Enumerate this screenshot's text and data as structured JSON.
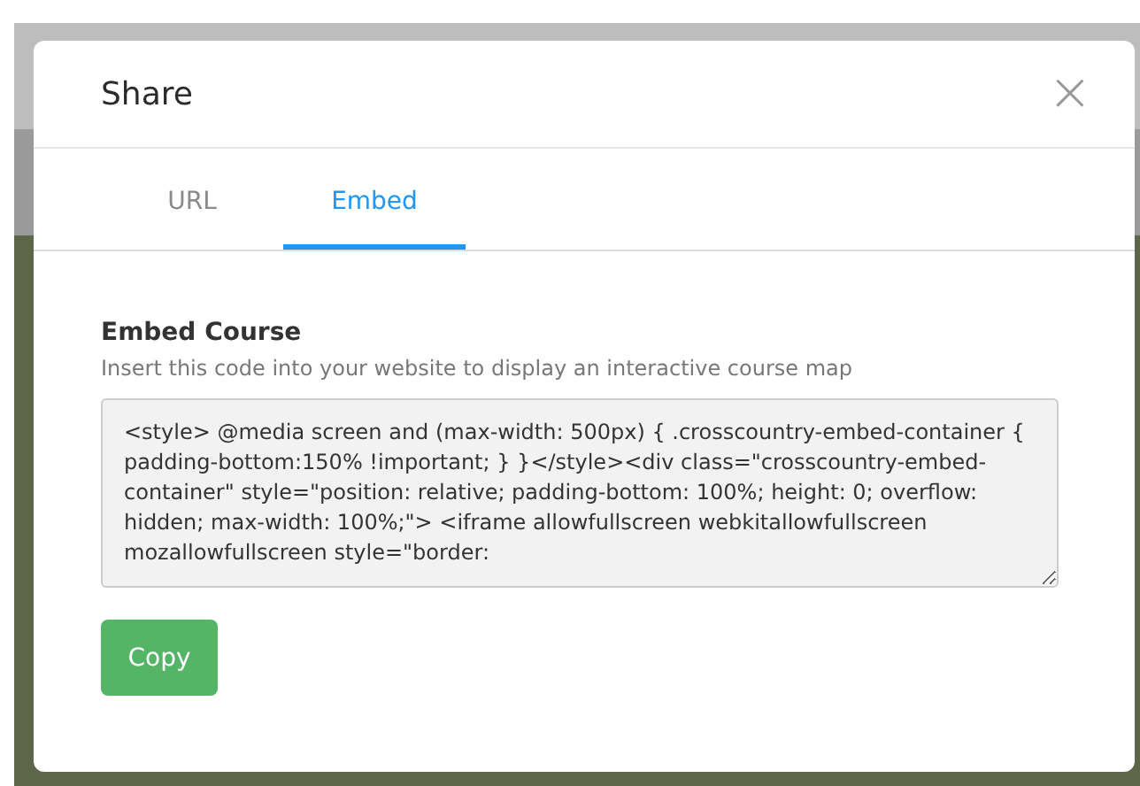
{
  "dialog": {
    "title": "Share",
    "close": "×"
  },
  "tabs": [
    {
      "label": "URL",
      "selected": false
    },
    {
      "label": "Embed",
      "selected": true
    }
  ],
  "embed": {
    "heading": "Embed Course",
    "description": "Insert this code into your website to display an interactive course map",
    "code": "<style> @media screen and (max-width: 500px) { .crosscountry-embed-container { padding-bottom:150% !important; } }</style><div class=\"crosscountry-embed-container\" style=\"position: relative; padding-bottom: 100%; height: 0; overflow: hidden; max-width: 100%;\"> <iframe allowfullscreen webkitallowfullscreen mozallowfullscreen style=\"border:"
  },
  "buttons": [
    {
      "label": "Copy"
    }
  ]
}
